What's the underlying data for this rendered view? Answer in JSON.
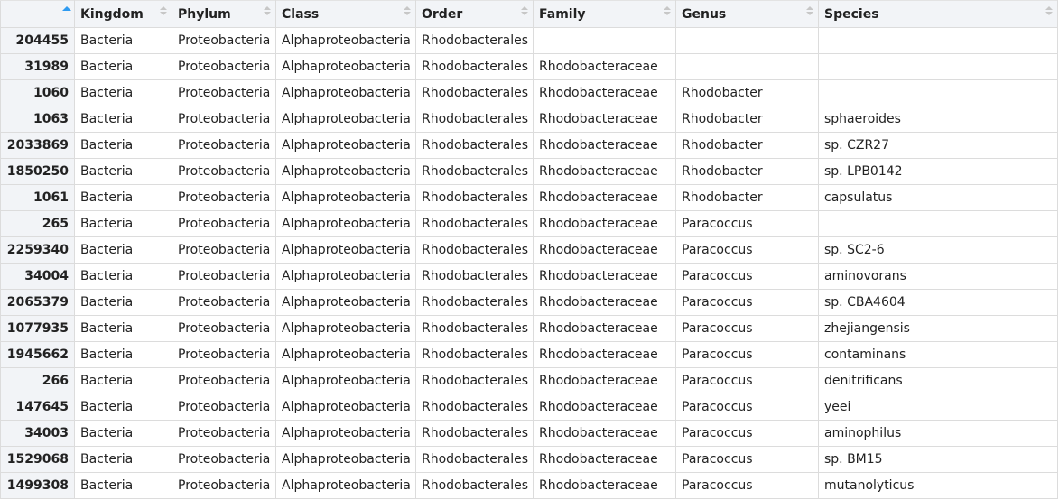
{
  "table": {
    "headers": [
      "",
      "Kingdom",
      "Phylum",
      "Class",
      "Order",
      "Family",
      "Genus",
      "Species"
    ],
    "sorted_column": "index",
    "sort_direction": "ascending",
    "rows": [
      [
        "204455",
        "Bacteria",
        "Proteobacteria",
        "Alphaproteobacteria",
        "Rhodobacterales",
        "",
        "",
        ""
      ],
      [
        "31989",
        "Bacteria",
        "Proteobacteria",
        "Alphaproteobacteria",
        "Rhodobacterales",
        "Rhodobacteraceae",
        "",
        ""
      ],
      [
        "1060",
        "Bacteria",
        "Proteobacteria",
        "Alphaproteobacteria",
        "Rhodobacterales",
        "Rhodobacteraceae",
        "Rhodobacter",
        ""
      ],
      [
        "1063",
        "Bacteria",
        "Proteobacteria",
        "Alphaproteobacteria",
        "Rhodobacterales",
        "Rhodobacteraceae",
        "Rhodobacter",
        "sphaeroides"
      ],
      [
        "2033869",
        "Bacteria",
        "Proteobacteria",
        "Alphaproteobacteria",
        "Rhodobacterales",
        "Rhodobacteraceae",
        "Rhodobacter",
        "sp. CZR27"
      ],
      [
        "1850250",
        "Bacteria",
        "Proteobacteria",
        "Alphaproteobacteria",
        "Rhodobacterales",
        "Rhodobacteraceae",
        "Rhodobacter",
        "sp. LPB0142"
      ],
      [
        "1061",
        "Bacteria",
        "Proteobacteria",
        "Alphaproteobacteria",
        "Rhodobacterales",
        "Rhodobacteraceae",
        "Rhodobacter",
        "capsulatus"
      ],
      [
        "265",
        "Bacteria",
        "Proteobacteria",
        "Alphaproteobacteria",
        "Rhodobacterales",
        "Rhodobacteraceae",
        "Paracoccus",
        ""
      ],
      [
        "2259340",
        "Bacteria",
        "Proteobacteria",
        "Alphaproteobacteria",
        "Rhodobacterales",
        "Rhodobacteraceae",
        "Paracoccus",
        "sp. SC2-6"
      ],
      [
        "34004",
        "Bacteria",
        "Proteobacteria",
        "Alphaproteobacteria",
        "Rhodobacterales",
        "Rhodobacteraceae",
        "Paracoccus",
        "aminovorans"
      ],
      [
        "2065379",
        "Bacteria",
        "Proteobacteria",
        "Alphaproteobacteria",
        "Rhodobacterales",
        "Rhodobacteraceae",
        "Paracoccus",
        "sp. CBA4604"
      ],
      [
        "1077935",
        "Bacteria",
        "Proteobacteria",
        "Alphaproteobacteria",
        "Rhodobacterales",
        "Rhodobacteraceae",
        "Paracoccus",
        "zhejiangensis"
      ],
      [
        "1945662",
        "Bacteria",
        "Proteobacteria",
        "Alphaproteobacteria",
        "Rhodobacterales",
        "Rhodobacteraceae",
        "Paracoccus",
        "contaminans"
      ],
      [
        "266",
        "Bacteria",
        "Proteobacteria",
        "Alphaproteobacteria",
        "Rhodobacterales",
        "Rhodobacteraceae",
        "Paracoccus",
        "denitrificans"
      ],
      [
        "147645",
        "Bacteria",
        "Proteobacteria",
        "Alphaproteobacteria",
        "Rhodobacterales",
        "Rhodobacteraceae",
        "Paracoccus",
        "yeei"
      ],
      [
        "34003",
        "Bacteria",
        "Proteobacteria",
        "Alphaproteobacteria",
        "Rhodobacterales",
        "Rhodobacteraceae",
        "Paracoccus",
        "aminophilus"
      ],
      [
        "1529068",
        "Bacteria",
        "Proteobacteria",
        "Alphaproteobacteria",
        "Rhodobacterales",
        "Rhodobacteraceae",
        "Paracoccus",
        "sp. BM15"
      ],
      [
        "1499308",
        "Bacteria",
        "Proteobacteria",
        "Alphaproteobacteria",
        "Rhodobacterales",
        "Rhodobacteraceae",
        "Paracoccus",
        "mutanolyticus"
      ]
    ]
  },
  "colors": {
    "header_bg": "#f2f4f7",
    "sort_active": "#2f9bf1",
    "sort_inactive": "#c7c7c7",
    "border": "#dcdcdc"
  }
}
